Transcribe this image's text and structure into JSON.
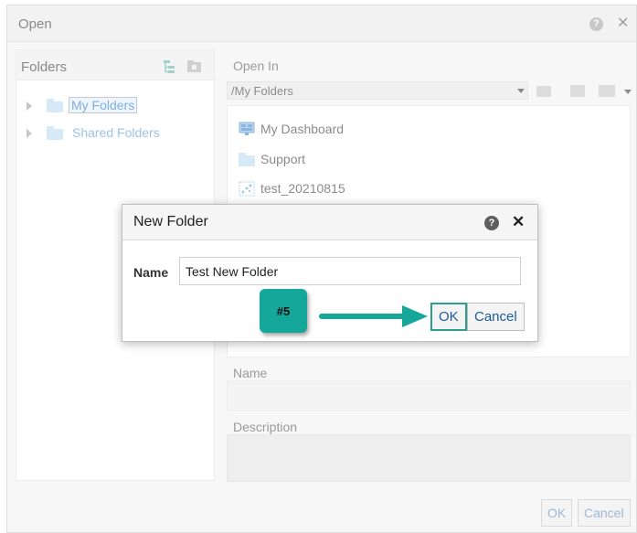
{
  "dialog": {
    "title": "Open",
    "ok_label": "OK",
    "cancel_label": "Cancel"
  },
  "folders_panel": {
    "title": "Folders",
    "items": [
      {
        "label": "My Folders",
        "selected": true
      },
      {
        "label": "Shared Folders",
        "selected": false
      }
    ]
  },
  "open_in": {
    "label": "Open In",
    "path": "/My Folders"
  },
  "file_list": [
    {
      "label": "My Dashboard",
      "icon": "dashboard-icon"
    },
    {
      "label": "Support",
      "icon": "folder-icon"
    },
    {
      "label": "test_20210815",
      "icon": "analysis-icon"
    }
  ],
  "fields": {
    "name_label": "Name",
    "description_label": "Description"
  },
  "new_folder_dialog": {
    "title": "New Folder",
    "name_label": "Name",
    "name_value": "Test New Folder",
    "ok_label": "OK",
    "cancel_label": "Cancel"
  },
  "callout": {
    "label": "#5",
    "color": "#15a79a"
  }
}
